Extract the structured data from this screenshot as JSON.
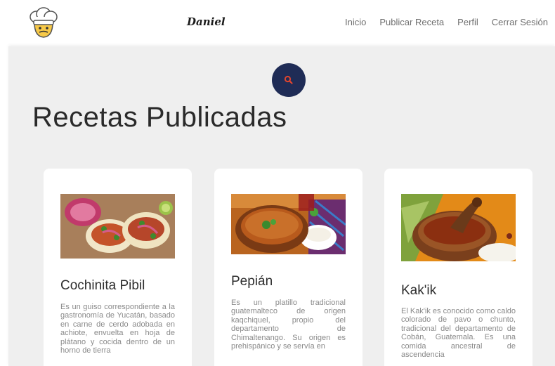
{
  "navbar": {
    "brand": "Daniel",
    "logo_icon": "chef-hat-avatar-icon",
    "links": [
      "Inicio",
      "Publicar Receta",
      "Perfil",
      "Cerrar Sesión"
    ]
  },
  "main": {
    "search_icon": "search-icon",
    "title": "Recetas Publicadas"
  },
  "recipes": [
    {
      "title": "Cochinita Pibil",
      "description": "Es un guiso correspondiente a la gastronomía de Yucatán, basado en carne de cerdo adobada en achiote, envuelta en hoja de plátano y cocida dentro de un horno de tierra"
    },
    {
      "title": "Pepián",
      "description": "Es un platillo tradicional guatemalteco de origen kaqchiquel, propio del departamento de Chimaltenango. Su origen es prehispánico y se servía en"
    },
    {
      "title": "Kak'ik",
      "description": "El Kak'ik es conocido como caldo colorado de pavo o chunto, tradicional del departamento de Cobán, Guatemala. Es una comida ancestral de ascendencia"
    }
  ],
  "colors": {
    "navy": "#1f2c56",
    "search_accent": "#e0452e",
    "background": "#efefef"
  }
}
